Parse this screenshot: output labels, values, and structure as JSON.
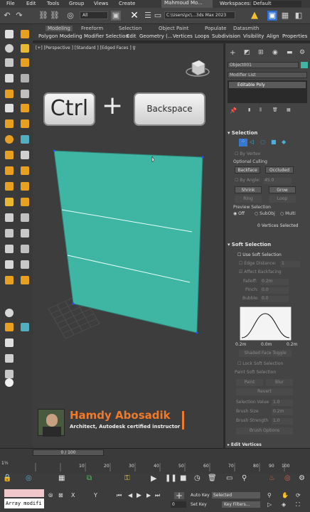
{
  "menu": [
    "File",
    "Edit",
    "Tools",
    "Group",
    "Views",
    "Create"
  ],
  "window_tab": "Mahmoud Mo...",
  "workspace": {
    "label": "Workspaces:",
    "value": "Default"
  },
  "toolbar": {
    "filter_value": "All",
    "path_value": "C:\\Users\\pc\\...3ds Max 2023"
  },
  "ribbon": {
    "tabs": [
      "Modeling",
      "Freeform",
      "Selection",
      "Object Paint",
      "Populate",
      "Datasmith"
    ],
    "sub": [
      "Polygon Modeling",
      "Modifier Selection",
      "Edit",
      "Geometry (...",
      "Vertices",
      "Loops",
      "Subdivision",
      "Visibility",
      "Align",
      "Properties"
    ]
  },
  "viewport": {
    "label": "[+] [Perspective ] [Standard ] [Edged Faces ]",
    "key_ctrl": "Ctrl",
    "key_plus": "+",
    "key_backspace": "Backspace",
    "poly_color": "#3fb5a3"
  },
  "watermark": {
    "name": "Hamdy Abosadik",
    "subtitle": "Architect, Autodesk certified instructor"
  },
  "command_panel": {
    "object_name": "Object001",
    "modifier_list": "Modifier List",
    "stack_item": "Editable Poly",
    "selection": {
      "title": "Selection",
      "by_vertex": "By Vertex",
      "optional_culling": "Optional Culling",
      "backface": "Backface",
      "occluded": "Occluded",
      "by_angle": "By Angle:",
      "angle_value": "45.0",
      "shrink": "Shrink",
      "grow": "Grow",
      "ring": "Ring",
      "loop": "Loop",
      "preview_selection": "Preview Selection",
      "off": "Off",
      "subobj": "SubObj",
      "multi": "Multi",
      "status": "0 Vertices Selected"
    },
    "soft_selection": {
      "title": "Soft Selection",
      "use_soft": "Use Soft Selection",
      "edge_distance": "Edge Distance:",
      "edge_value": "1",
      "affect_backfacing": "Affect Backfacing",
      "falloff": "Falloff:",
      "falloff_value": "0.2m",
      "pinch": "Pinch:",
      "pinch_value": "0.0",
      "bubble": "Bubble:",
      "bubble_value": "0.0",
      "curve_left": "0.2m",
      "curve_mid": "0.0m",
      "curve_right": "0.2m",
      "shaded_face_toggle": "Shaded Face Toggle",
      "lock_soft": "Lock Soft Selection",
      "paint_soft": "Paint Soft Selection",
      "paint": "Paint",
      "blur": "Blur",
      "revert": "Revert",
      "selection_value": "Selection Value",
      "selection_value_num": "1.0",
      "brush_size": "Brush Size",
      "brush_size_num": "0.2m",
      "brush_strength": "Brush Strength",
      "brush_strength_num": "1.0",
      "brush_options": "Brush Options"
    },
    "edit_vertices": "Edit Vertices"
  },
  "timeline": {
    "frame": "0 / 100",
    "ticks": [
      "10",
      "20",
      "30",
      "40",
      "50",
      "60",
      "70",
      "80",
      "90",
      "100"
    ]
  },
  "bottom": {
    "listener": "Array modifi",
    "auto_key": "Auto Key",
    "set_key": "Set Key",
    "selected": "Selected",
    "key_filters": "Key Filters...",
    "frame_value": "0"
  }
}
